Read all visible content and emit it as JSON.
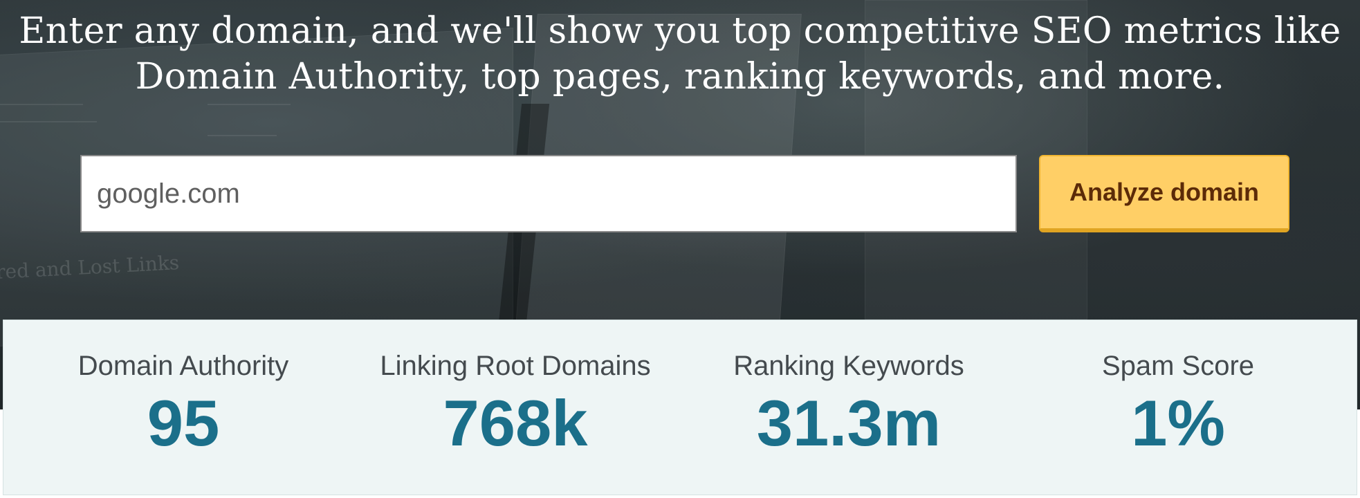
{
  "hero": {
    "headline_line1": "Enter any domain, and we'll show you top competitive SEO metrics like",
    "headline_line2": "Domain Authority, top pages, ranking keywords, and more.",
    "background_caption": "red and Lost Links"
  },
  "search": {
    "placeholder": "google.com",
    "value": ""
  },
  "analyze_button": {
    "label": "Analyze domain"
  },
  "stats": [
    {
      "label": "Domain Authority",
      "value": "95"
    },
    {
      "label": "Linking Root Domains",
      "value": "768k"
    },
    {
      "label": "Ranking Keywords",
      "value": "31.3m"
    },
    {
      "label": "Spam Score",
      "value": "1%"
    }
  ],
  "colors": {
    "accent_button": "#ffcf66",
    "button_text": "#5c2b08",
    "stat_value": "#1b6f8a",
    "stats_background": "#eef5f5"
  }
}
